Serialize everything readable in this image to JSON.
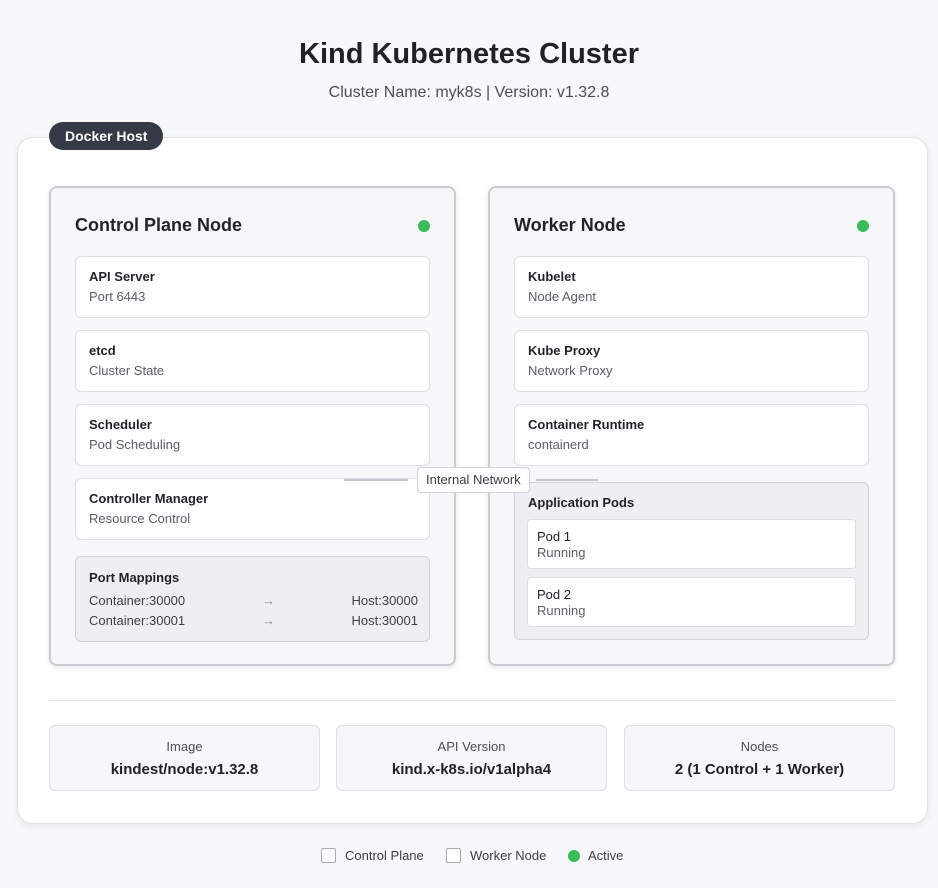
{
  "header": {
    "title": "Kind Kubernetes Cluster",
    "subtitle": "Cluster Name: myk8s | Version: v1.32.8"
  },
  "host": {
    "badge": "Docker Host"
  },
  "control_plane": {
    "title": "Control Plane Node",
    "status": "Active",
    "components": [
      {
        "name": "API Server",
        "desc": "Port 6443"
      },
      {
        "name": "etcd",
        "desc": "Cluster State"
      },
      {
        "name": "Scheduler",
        "desc": "Pod Scheduling"
      },
      {
        "name": "Controller Manager",
        "desc": "Resource Control"
      }
    ],
    "port_mappings": {
      "title": "Port Mappings",
      "arrow": "→",
      "rows": [
        {
          "from": "Container:30000",
          "to": "Host:30000"
        },
        {
          "from": "Container:30001",
          "to": "Host:30001"
        }
      ]
    }
  },
  "worker": {
    "title": "Worker Node",
    "status": "Active",
    "components": [
      {
        "name": "Kubelet",
        "desc": "Node Agent"
      },
      {
        "name": "Kube Proxy",
        "desc": "Network Proxy"
      },
      {
        "name": "Container Runtime",
        "desc": "containerd"
      }
    ],
    "pods": {
      "title": "Application Pods",
      "items": [
        {
          "name": "Pod 1",
          "status": "Running"
        },
        {
          "name": "Pod 2",
          "status": "Running"
        }
      ]
    }
  },
  "network": {
    "label": "Internal Network"
  },
  "info": [
    {
      "label": "Image",
      "value": "kindest/node:v1.32.8"
    },
    {
      "label": "API Version",
      "value": "kind.x-k8s.io/v1alpha4"
    },
    {
      "label": "Nodes",
      "value": "2 (1 Control + 1 Worker)"
    }
  ],
  "legend": {
    "control_plane": "Control Plane",
    "worker": "Worker Node",
    "active": "Active"
  },
  "colors": {
    "active": "#3dba5b",
    "badge": "#343a46"
  }
}
